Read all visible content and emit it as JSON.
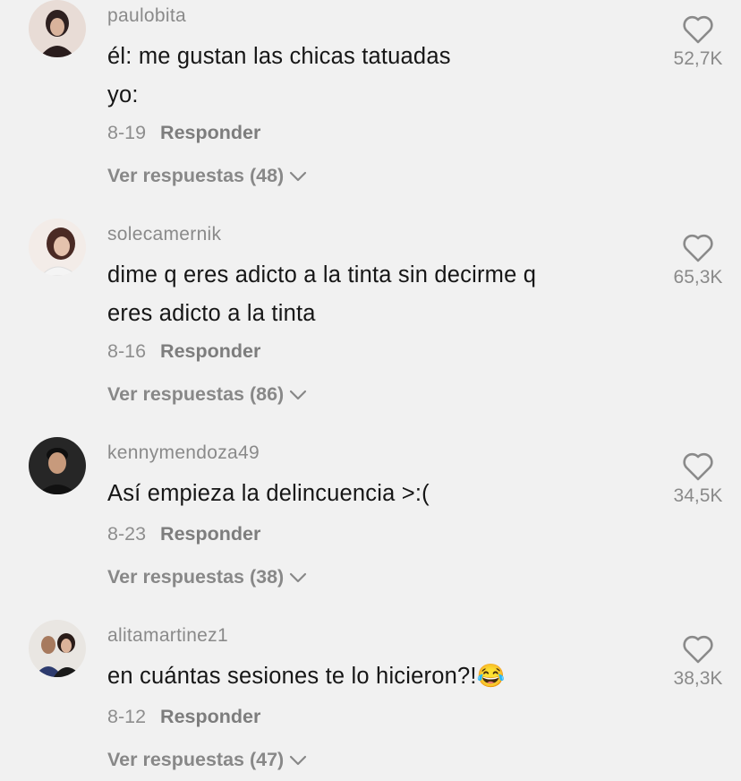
{
  "comments": [
    {
      "username": "paulobita",
      "text": [
        "él: me gustan las chicas tatuadas",
        "yo:"
      ],
      "date": "8-19",
      "reply_label": "Responder",
      "replies_label": "Ver respuestas (48)",
      "likes": "52,7K",
      "avatar_colors": [
        "#3a2a2a",
        "#e8dcd6"
      ]
    },
    {
      "username": "solecamernik",
      "text": [
        "dime q eres adicto a la tinta sin decirme q",
        "eres adicto a la tinta"
      ],
      "date": "8-16",
      "reply_label": "Responder",
      "replies_label": "Ver respuestas (86)",
      "likes": "65,3K",
      "avatar_colors": [
        "#4a2a24",
        "#f3ece8"
      ]
    },
    {
      "username": "kennymendoza49",
      "text": [
        "Así empieza la delincuencia >:("
      ],
      "date": "8-23",
      "reply_label": "Responder",
      "replies_label": "Ver respuestas (38)",
      "likes": "34,5K",
      "avatar_colors": [
        "#1c1c1c",
        "#c79a7c"
      ]
    },
    {
      "username": "alitamartinez1",
      "text": [
        "en cuántas sesiones te lo hicieron?!😂"
      ],
      "date": "8-12",
      "reply_label": "Responder",
      "replies_label": "Ver respuestas (47)",
      "likes": "38,3K",
      "avatar_colors": [
        "#2d3b6e",
        "#e9e6e2"
      ]
    }
  ]
}
